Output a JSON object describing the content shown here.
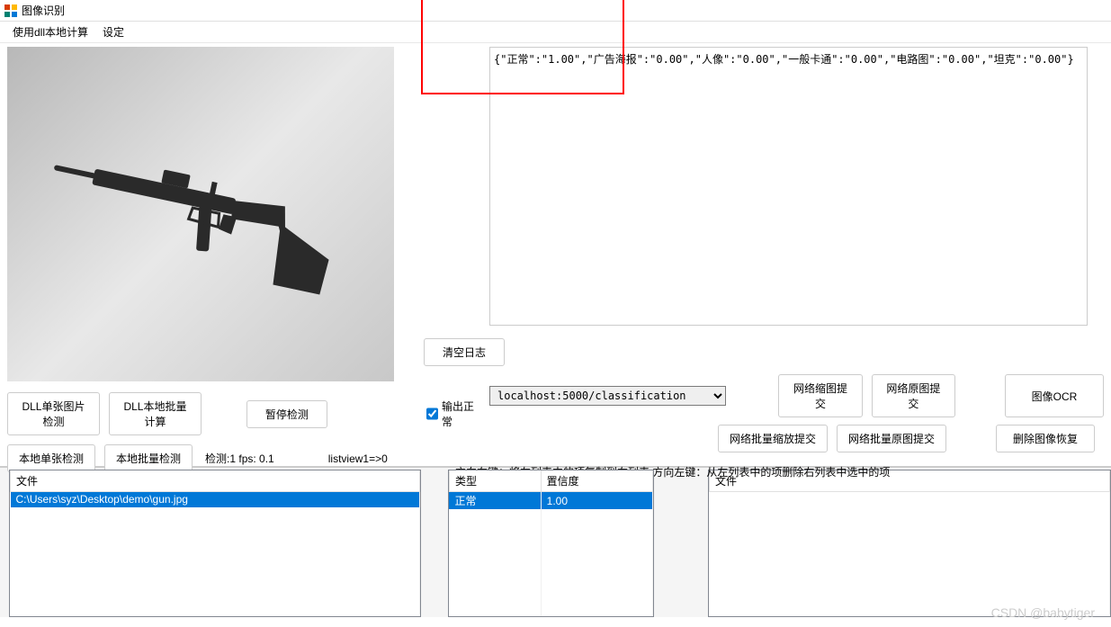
{
  "window": {
    "title": "图像识别"
  },
  "menu": {
    "items": [
      "使用dll本地计算",
      "设定"
    ]
  },
  "log": {
    "text": "{\"正常\":\"1.00\",\"广告海报\":\"0.00\",\"人像\":\"0.00\",\"一般卡通\":\"0.00\",\"电路图\":\"0.00\",\"坦克\":\"0.00\"}"
  },
  "buttons": {
    "clear_log": "清空日志",
    "dll_single": "DLL单张图片检测",
    "dll_batch": "DLL本地批量计算",
    "pause": "暂停检测",
    "local_single": "本地单张检测",
    "local_batch": "本地批量检测",
    "net_thumb": "网络缩图提交",
    "net_orig": "网络原图提交",
    "image_ocr": "图像OCR",
    "net_batch_thumb": "网络批量缩放提交",
    "net_batch_orig": "网络批量原图提交",
    "delete_restore": "删除图像恢复"
  },
  "checkbox": {
    "output_normal": "输出正常"
  },
  "status": {
    "detect": "检测:1 fps: 0.1",
    "listview": "listview1=>0"
  },
  "combo": {
    "url": "localhost:5000/classification"
  },
  "hint": {
    "text": "方向右键：将左列表中的项复制到右列表 方向左键：从左列表中的项删除右列表中选中的项"
  },
  "tables": {
    "left": {
      "headers": [
        "文件"
      ],
      "rows": [
        {
          "file": "C:\\Users\\syz\\Desktop\\demo\\gun.jpg",
          "selected": true
        }
      ]
    },
    "mid": {
      "headers": [
        "类型",
        "置信度"
      ],
      "rows": [
        {
          "type": "正常",
          "conf": "1.00",
          "selected": true
        }
      ]
    },
    "right": {
      "headers": [
        "文件"
      ],
      "rows": []
    }
  },
  "watermark": "CSDN @babytiger"
}
